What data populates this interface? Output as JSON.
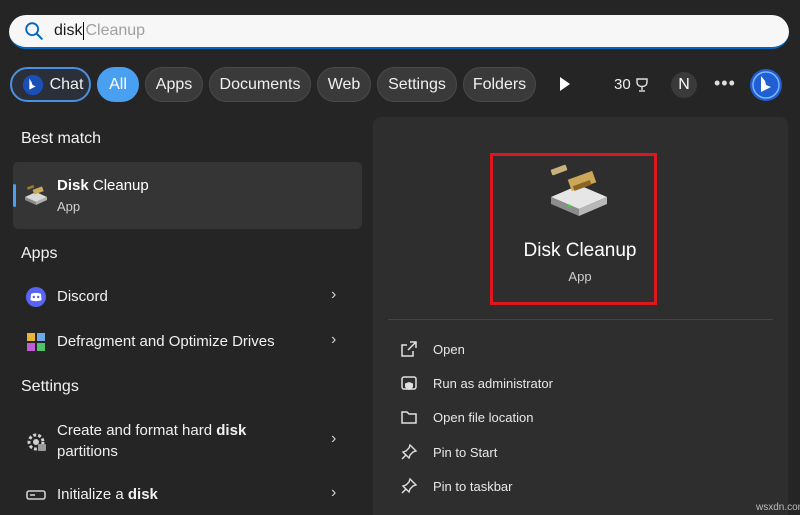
{
  "search": {
    "typed": "disk",
    "suggestion": "Cleanup"
  },
  "filters": {
    "chat": "Chat",
    "all": "All",
    "apps": "Apps",
    "documents": "Documents",
    "web": "Web",
    "settings": "Settings",
    "folders": "Folders"
  },
  "header": {
    "points": "30",
    "avatar": "N",
    "more": "•••"
  },
  "left": {
    "best_match_heading": "Best match",
    "best": {
      "title_pre": "Disk",
      "title_post": " Cleanup",
      "subtitle": "App"
    },
    "apps_heading": "Apps",
    "apps": [
      {
        "label": "Discord"
      },
      {
        "label": "Defragment and Optimize Drives"
      }
    ],
    "settings_heading": "Settings",
    "settings": [
      {
        "line1_pre": "Create and format hard ",
        "line1_bold": "disk",
        "line2": "partitions"
      },
      {
        "pre": "Initialize a ",
        "bold": "disk"
      }
    ]
  },
  "panel": {
    "title": "Disk Cleanup",
    "subtitle": "App",
    "actions": [
      {
        "label": "Open",
        "icon": "open-external-icon"
      },
      {
        "label": "Run as administrator",
        "icon": "shield-admin-icon"
      },
      {
        "label": "Open file location",
        "icon": "folder-icon"
      },
      {
        "label": "Pin to Start",
        "icon": "pin-icon"
      },
      {
        "label": "Pin to taskbar",
        "icon": "pin-icon"
      }
    ]
  },
  "watermark": "wsxdn.com",
  "colors": {
    "accent": "#4aa0f0",
    "highlight_border": "#e0161e",
    "background": "#252525",
    "panel": "#2e2e2e"
  }
}
